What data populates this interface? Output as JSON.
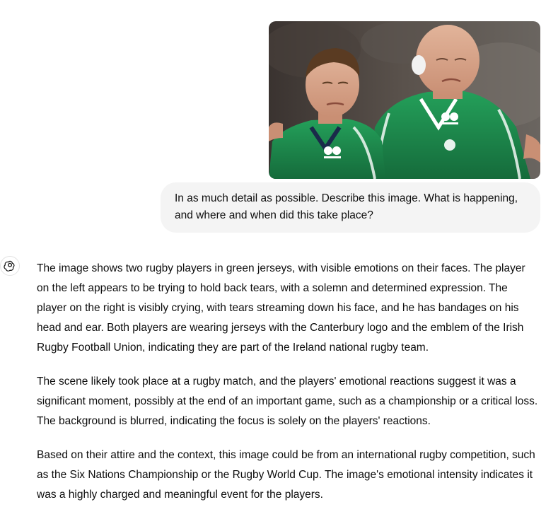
{
  "user_message": {
    "image": {
      "subject": "image-upload"
    },
    "text": "In as much detail as possible. Describe this image. What is happening, and where and when did this take place?"
  },
  "assistant": {
    "avatar_icon": "openai-logo-icon",
    "paragraphs": [
      "The image shows two rugby players in green jerseys, with visible emotions on their faces. The player on the left appears to be trying to hold back tears, with a solemn and determined expression. The player on the right is visibly crying, with tears streaming down his face, and he has bandages on his head and ear. Both players are wearing jerseys with the Canterbury logo and the emblem of the Irish Rugby Football Union, indicating they are part of the Ireland national rugby team.",
      "The scene likely took place at a rugby match, and the players' emotional reactions suggest it was a significant moment, possibly at the end of an important game, such as a championship or a critical loss. The background is blurred, indicating the focus is solely on the players' reactions.",
      "Based on their attire and the context, this image could be from an international rugby competition, such as the Six Nations Championship or the Rugby World Cup. The image's emotional intensity indicates it was a highly charged and meaningful event for the players."
    ]
  },
  "colors": {
    "jersey_green": "#1f8a4c",
    "bubble_bg": "#f4f4f4",
    "text": "#0d0d0d"
  }
}
